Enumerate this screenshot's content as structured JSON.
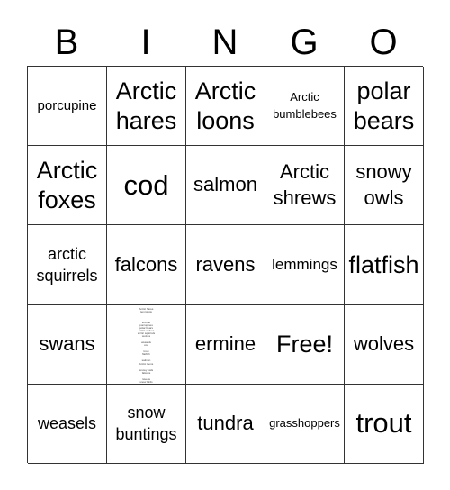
{
  "header": {
    "letters": [
      "B",
      "I",
      "N",
      "G",
      "O"
    ]
  },
  "board": {
    "rows": [
      [
        "porcupine",
        "Arctic hares",
        "Arctic loons",
        "Arctic bumblebees",
        "polar bears"
      ],
      [
        "Arctic foxes",
        "cod",
        "salmon",
        "Arctic shrews",
        "snowy owls"
      ],
      [
        "arctic squirrels",
        "falcons",
        "ravens",
        "lemmings",
        "flatfish"
      ],
      [
        "swans",
        "",
        "ermine",
        "Free!",
        "wolves"
      ],
      [
        "weasels",
        "snow buntings",
        "tundra",
        "grasshoppers",
        "trout"
      ]
    ],
    "wordlist_cell": [
      "Tundra",
      "Arctic foxes",
      "",
      "Arctic hares",
      "lemmings",
      "",
      "",
      "ermine",
      "porcupines",
      "polar bears",
      "Arctic wolves",
      "arctic squirrels",
      "wolves",
      "",
      "weasels",
      "cod",
      "",
      "trout",
      "flatfish",
      "",
      "salmon",
      "Arctic loons",
      "",
      "snowy owls",
      "falcons",
      "",
      "ravens",
      "snow birds",
      "snow buntings",
      "swans"
    ]
  }
}
